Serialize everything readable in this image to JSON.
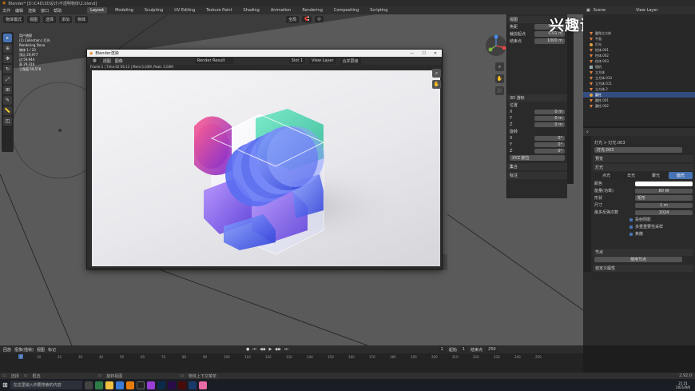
{
  "app": {
    "title": "Blender* [D:\\C4D\\3D设计\\不透明物体\\2.blend]"
  },
  "menu": [
    "文件",
    "编辑",
    "渲染",
    "窗口",
    "帮助"
  ],
  "workspaces": [
    "Layout",
    "Modeling",
    "Sculpting",
    "UV Editing",
    "Texture Paint",
    "Shading",
    "Animation",
    "Rendering",
    "Compositing",
    "Scripting"
  ],
  "workspace_active": "Layout",
  "viewport": {
    "mode": "物体模式",
    "menus": [
      "视图",
      "选择",
      "添加",
      "物体"
    ],
    "transform": "全局",
    "stats": [
      "用户透视",
      "(1) Collection | 灯光",
      "Rendering Done",
      "物体  1 / 23",
      "顶点  29,977",
      "边  59,944",
      "面  29,316",
      "三角面  59,578"
    ]
  },
  "npanel": {
    "sec_view": "视图",
    "focal_label": "焦距",
    "focal": "50 mm",
    "clip_start_label": "裁剪起点",
    "clip_start": "0.01 m",
    "clip_end_label": "结束点",
    "clip_end": "1000 m",
    "sec_3d": "3D 游标",
    "location": "位置",
    "x": "X",
    "y": "Y",
    "z": "Z",
    "zero": "0 m",
    "rotation": "旋转",
    "deg": "0°",
    "order": "XYZ 欧拉",
    "sec_coll": "集合",
    "sec_ann": "标注"
  },
  "render_window": {
    "title": "Blender渲染",
    "menus": [
      "视图",
      "图像"
    ],
    "slot": "Render Result",
    "layer": "View Layer",
    "pass": "合并层级",
    "slot2": "Slot 1",
    "info": "Frame:1 | Time:02:56.13 | Mem:5.03M, Peak: 5.03M"
  },
  "outliner": {
    "scene": "Scene",
    "view_layer": "View Layer",
    "items": [
      "圆角立方体",
      "平面",
      "灯光",
      "柱体.001",
      "柱体.002",
      "柱体.003",
      "相机",
      "立方体",
      "立方体.010",
      "立方体.011",
      "立方体.2",
      "圆柱",
      "圆柱.001",
      "圆柱.002"
    ],
    "selected_index": 11
  },
  "properties": {
    "breadcrumb": "灯光  >  灯光.003",
    "light_name": "灯光.003",
    "sec_preview": "预览",
    "sec_light": "灯光",
    "types": [
      "点光",
      "日光",
      "聚光",
      "面光"
    ],
    "type_active": 3,
    "color_label": "颜色",
    "power_label": "能量(功率)",
    "power": "80 W",
    "shape_label": "形状",
    "shape": "矩形",
    "size_label": "尺寸",
    "size": "1 m",
    "spec_label": "最多反弹次数",
    "spec": "1024",
    "checks": [
      "投射阴影",
      "多重重要性采样",
      "焦散"
    ],
    "sec_nodes": "节点",
    "use_nodes": "使用节点",
    "sec_custom": "自定义属性"
  },
  "timeline": {
    "menus": [
      "回放",
      "抠像(插帧)",
      "视图",
      "标记"
    ],
    "frame": "1",
    "start_label": "起始",
    "start": "1",
    "end_label": "结束点",
    "end": "250",
    "ticks": [
      "10",
      "20",
      "30",
      "40",
      "50",
      "60",
      "70",
      "80",
      "90",
      "100",
      "110",
      "120",
      "130",
      "140",
      "150",
      "160",
      "170",
      "180",
      "190",
      "200",
      "210",
      "220",
      "230",
      "240",
      "250"
    ]
  },
  "statusbar": [
    "选择",
    "框选",
    "旋转视图",
    "物体上下文菜单"
  ],
  "version": "2.92.0",
  "taskbar": {
    "search": "在这里输入你要搜索的内容",
    "time": "21:21",
    "date": "2021/9/6"
  },
  "watermark": "兴趣设计师k",
  "colors": {
    "accent": "#4772b3",
    "selection": "#334d80",
    "light_icon": "#e0a040",
    "mesh_icon": "#e08040"
  }
}
